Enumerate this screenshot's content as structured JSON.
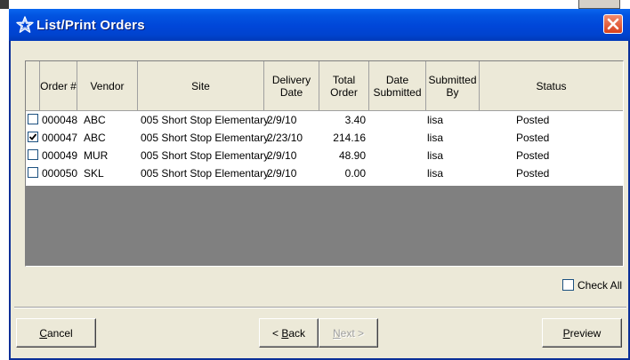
{
  "window": {
    "title": "List/Print Orders"
  },
  "columns": [
    {
      "label": ""
    },
    {
      "label": "Order #"
    },
    {
      "label": "Vendor"
    },
    {
      "label": "Site"
    },
    {
      "label": "Delivery Date"
    },
    {
      "label": "Total Order"
    },
    {
      "label": "Date Submitted"
    },
    {
      "label": "Submitted By"
    },
    {
      "label": "Status"
    }
  ],
  "rows": [
    {
      "checked": false,
      "order": "000048",
      "vendor": "ABC",
      "site": "005 Short Stop Elementary",
      "delivery": "2/9/10",
      "total": "3.40",
      "submitted": "",
      "by": "lisa",
      "status": "Posted"
    },
    {
      "checked": true,
      "order": "000047",
      "vendor": "ABC",
      "site": "005 Short Stop Elementary",
      "delivery": "2/23/10",
      "total": "214.16",
      "submitted": "",
      "by": "lisa",
      "status": "Posted"
    },
    {
      "checked": false,
      "order": "000049",
      "vendor": "MUR",
      "site": "005 Short Stop Elementary",
      "delivery": "2/9/10",
      "total": "48.90",
      "submitted": "",
      "by": "lisa",
      "status": "Posted"
    },
    {
      "checked": false,
      "order": "000050",
      "vendor": "SKL",
      "site": "005 Short Stop Elementary",
      "delivery": "2/9/10",
      "total": "0.00",
      "submitted": "",
      "by": "lisa",
      "status": "Posted"
    }
  ],
  "check_all": {
    "label": "Check All",
    "checked": false
  },
  "buttons": {
    "cancel": {
      "mnemonic": "C",
      "rest": "ancel"
    },
    "back": {
      "prefix": "< ",
      "mnemonic": "B",
      "rest": "ack"
    },
    "next": {
      "mnemonic": "N",
      "rest": "ext >",
      "disabled": true
    },
    "preview": {
      "mnemonic": "P",
      "rest": "review"
    }
  },
  "colors": {
    "title_bar": "#0046d8",
    "dialog_bg": "#ece9d8",
    "grid_empty": "#808080",
    "close_button": "#d8401b"
  }
}
